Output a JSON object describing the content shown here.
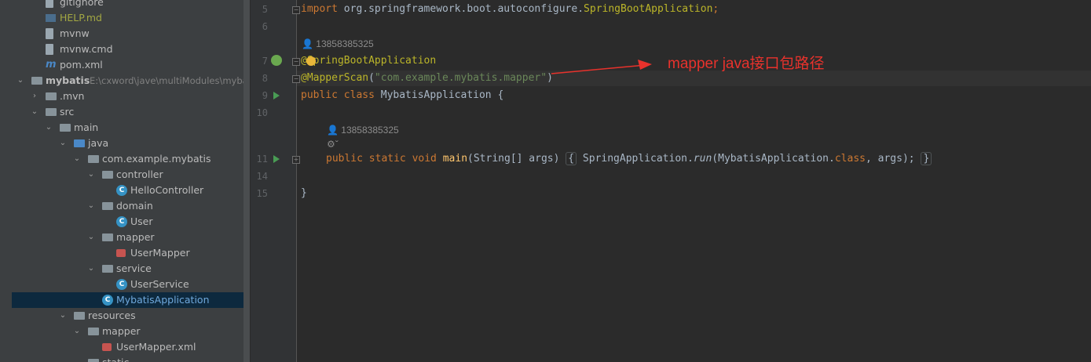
{
  "project_tree": {
    "items": [
      {
        "label": "gitignore",
        "icon": "file-icon",
        "chevron": "",
        "name": "tree-item-gitignore"
      },
      {
        "label": "HELP.md",
        "icon": "markdown-file-icon",
        "chevron": "",
        "name": "tree-item-help-md",
        "color": "#a3a843"
      },
      {
        "label": "mvnw",
        "icon": "file-icon",
        "chevron": "",
        "name": "tree-item-mvnw"
      },
      {
        "label": "mvnw.cmd",
        "icon": "file-icon",
        "chevron": "",
        "name": "tree-item-mvnw-cmd"
      },
      {
        "label": "pom.xml",
        "icon": "maven-icon",
        "chevron": "",
        "name": "tree-item-pom"
      },
      {
        "label": "mybatis",
        "path": "E:\\cxword\\jave\\multiModules\\myba",
        "icon": "module-folder-icon",
        "chevron": "expanded",
        "name": "tree-item-mybatis"
      },
      {
        "label": ".mvn",
        "icon": "folder-icon",
        "chevron": "collapsed",
        "name": "tree-item-mvn"
      },
      {
        "label": "src",
        "icon": "folder-icon",
        "chevron": "expanded",
        "name": "tree-item-src"
      },
      {
        "label": "main",
        "icon": "folder-icon",
        "chevron": "expanded",
        "name": "tree-item-main"
      },
      {
        "label": "java",
        "icon": "source-folder-icon",
        "chevron": "expanded",
        "name": "tree-item-java"
      },
      {
        "label": "com.example.mybatis",
        "icon": "package-icon",
        "chevron": "expanded",
        "name": "tree-item-package"
      },
      {
        "label": "controller",
        "icon": "package-icon",
        "chevron": "expanded",
        "name": "tree-item-controller"
      },
      {
        "label": "HelloController",
        "icon": "class-icon",
        "chevron": "",
        "name": "tree-item-hellocontroller"
      },
      {
        "label": "domain",
        "icon": "package-icon",
        "chevron": "expanded",
        "name": "tree-item-domain"
      },
      {
        "label": "User",
        "icon": "class-icon",
        "chevron": "",
        "name": "tree-item-user"
      },
      {
        "label": "mapper",
        "icon": "package-icon",
        "chevron": "expanded",
        "name": "tree-item-mapper"
      },
      {
        "label": "UserMapper",
        "icon": "mybatis-mapper-icon",
        "chevron": "",
        "name": "tree-item-usermapper"
      },
      {
        "label": "service",
        "icon": "package-icon",
        "chevron": "expanded",
        "name": "tree-item-service"
      },
      {
        "label": "UserService",
        "icon": "class-icon",
        "chevron": "",
        "name": "tree-item-userservice"
      },
      {
        "label": "MybatisApplication",
        "icon": "spring-boot-class-icon",
        "chevron": "",
        "name": "tree-item-mybatisapplication",
        "selected": true
      },
      {
        "label": "resources",
        "icon": "resources-folder-icon",
        "chevron": "expanded",
        "name": "tree-item-resources"
      },
      {
        "label": "mapper",
        "icon": "folder-icon",
        "chevron": "expanded",
        "name": "tree-item-resources-mapper"
      },
      {
        "label": "UserMapper.xml",
        "icon": "mybatis-xml-icon",
        "chevron": "",
        "name": "tree-item-usermapper-xml"
      },
      {
        "label": "static",
        "icon": "folder-icon",
        "chevron": "",
        "name": "tree-item-static"
      }
    ]
  },
  "editor": {
    "line_numbers": [
      "5",
      "6",
      "7",
      "8",
      "9",
      "10",
      "11",
      "14",
      "15"
    ],
    "import_kw": "import",
    "import_path": "org.springframework.boot.autoconfigure.",
    "import_class": "SpringBootApplication",
    "import_semi": ";",
    "author_hint_1": "13858385325",
    "annotation_1": "@SpringBootApplication",
    "annotation_2": "@MapperScan",
    "annotation_2_open": "(",
    "annotation_2_arg": "\"com.example.mybatis.mapper\"",
    "annotation_2_close": ")",
    "class_kw": "public class ",
    "class_name": "MybatisApplication {",
    "author_hint_2": "13858385325",
    "method_mods": "public static void ",
    "method_name": "main",
    "method_params": "(String[] args)",
    "brace_open": "{",
    "body_cls": " SpringApplication.",
    "body_run": "run",
    "body_args_a": "(MybatisApplication.",
    "body_class_kw": "class",
    "body_args_b": ", args);",
    "brace_close": "}",
    "closing_brace": "}"
  },
  "callout": {
    "text": "mapper java接口包路径",
    "color": "#e8322c"
  }
}
